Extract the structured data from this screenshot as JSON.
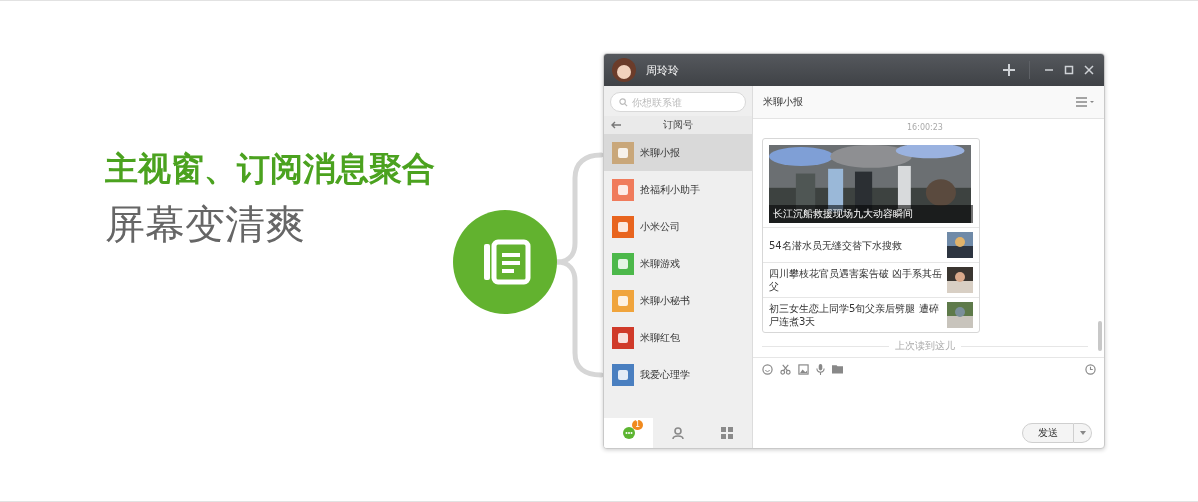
{
  "headline": "主视窗、订阅消息聚合",
  "subhead": "屏幕变清爽",
  "window": {
    "user_name": "周玲玲"
  },
  "sidebar": {
    "search": {
      "placeholder": "你想联系谁"
    },
    "header": "订阅号",
    "items": [
      {
        "name": "米聊小报",
        "selected": true
      },
      {
        "name": "抢福利小助手",
        "selected": false
      },
      {
        "name": "小米公司",
        "selected": false
      },
      {
        "name": "米聊游戏",
        "selected": false
      },
      {
        "name": "米聊小秘书",
        "selected": false
      },
      {
        "name": "米聊红包",
        "selected": false
      },
      {
        "name": "我爱心理学",
        "selected": false
      }
    ],
    "tabs": [
      {
        "kind": "chats",
        "selected": true,
        "badge": "1"
      },
      {
        "kind": "contacts",
        "selected": false
      },
      {
        "kind": "apps",
        "selected": false
      }
    ]
  },
  "chat": {
    "title": "米聊小报",
    "time": "16:00:23",
    "news": {
      "headline": "长江沉船救援现场九大动容瞬间",
      "items": [
        "54名潜水员无缝交替下水搜救",
        "四川攀枝花官员遇害案告破 凶手系其岳父",
        "初三女生恋上同学5旬父亲后劈腿 遭碎尸连煮3天"
      ]
    },
    "read_marker": "上次读到这儿",
    "send_label": "发送"
  }
}
